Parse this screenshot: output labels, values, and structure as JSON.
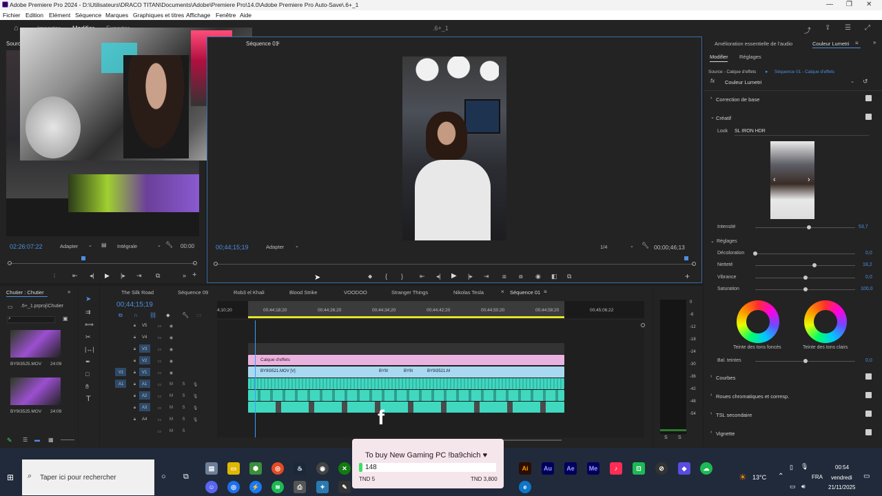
{
  "window": {
    "title": "Adobe Premiere Pro 2024 - D:\\Utilisateurs\\DRACO TITAN\\Documents\\Adobe\\Premiere Pro\\14.0\\Adobe Premiere Pro Auto-Save\\.6+_1"
  },
  "menu": [
    "Fichier",
    "Edition",
    "Elément",
    "Séquence",
    "Marques",
    "Graphiques et titres",
    "Affichage",
    "Fenêtre",
    "Aide"
  ],
  "workspace": {
    "tabs": [
      "Importer",
      "Modifier",
      "Exporter"
    ],
    "project_name": ".6+_1"
  },
  "source_monitor": {
    "tab": "Source",
    "timecode": "02:26:07:22",
    "fit": "Adapter",
    "quality": "Intégrale",
    "duration": "00:00"
  },
  "program_monitor": {
    "tab": "Séquence 01",
    "timecode": "00;44;15;19",
    "fit": "Adapter",
    "resolution": "1/4",
    "duration": "00;00;46;13"
  },
  "project_panel": {
    "tab": "Chutier : Chutier",
    "path": ".6+_1.prproj\\Chutier",
    "items": [
      {
        "name": "BY9I3525.MOV",
        "duration": "24:09"
      },
      {
        "name": "BY9I3525.MOV",
        "duration": "24:09"
      }
    ]
  },
  "timeline": {
    "tabs": [
      "The Silk Road",
      "Séquence 09",
      "Rob3 el Khali",
      "Blood Strike",
      "VOODOO",
      "Stranger Things",
      "Nikolas Tesla",
      "Séquence 01"
    ],
    "timecode": "00;44;15;19",
    "ruler": [
      "4;10;20",
      "00;44;18;20",
      "00;44;26;20",
      "00;44;34;20",
      "00;44;42;20",
      "00;44;50;20",
      "00;44;58;20",
      "00;45;06;22"
    ],
    "video_tracks": [
      "V5",
      "V4",
      "V3",
      "V2",
      "V1"
    ],
    "audio_tracks": [
      "A1",
      "A2",
      "A3",
      "A4"
    ],
    "source_patch": {
      "video": "V1",
      "audio": "A1"
    },
    "clips": {
      "adjustment": "Calque d'effets",
      "v1": [
        "BY9I3521.MOV [V]",
        "BY9I",
        "BY9I",
        "BY9I3521.M"
      ]
    },
    "meter_scale": [
      "0",
      "-6",
      "-12",
      "-18",
      "-24",
      "-30",
      "-36",
      "-42",
      "-48",
      "-54"
    ],
    "meter_solo": [
      "S",
      "S"
    ]
  },
  "right_panel": {
    "tabs": [
      "Amélioration essentielle de l'audio",
      "Couleur Lumetri"
    ],
    "subtabs": [
      "Modifier",
      "Réglages"
    ],
    "source_label": "Source - Calque d'effets",
    "sequence_label": "Séquence 01 - Calque d'effets",
    "fx_name": "Couleur Lumetri",
    "sections": {
      "basic": "Correction de base",
      "creative": "Créatif",
      "curves": "Courbes",
      "wheels": "Roues chromatiques et corresp.",
      "hsl": "TSL secondaire",
      "vignette": "Vignette"
    },
    "look_label": "Look",
    "look_value": "SL IRON HDR",
    "intensity": {
      "label": "Intensité",
      "value": "53,7",
      "level": 0.537
    },
    "adjustments_header": "Réglages",
    "sliders": [
      {
        "label": "Décoloration",
        "value": "0,0",
        "level": 0.0
      },
      {
        "label": "Netteté",
        "value": "18,2",
        "level": 0.59
      },
      {
        "label": "Vibrance",
        "value": "0,0",
        "level": 0.5
      },
      {
        "label": "Saturation",
        "value": "100,0",
        "level": 0.5
      }
    ],
    "shadow_tint": "Teinte des tons foncés",
    "highlight_tint": "Teinte des tons clairs",
    "tint_balance": {
      "label": "Bal. teintes",
      "value": "0,0",
      "level": 0.5
    }
  },
  "overlay": {
    "message": "To buy New Gaming PC !ba9chich ♥",
    "progress_value": "148",
    "progress_level": 0.024,
    "min": "TND 5",
    "max": "TND 3,800"
  },
  "taskbar": {
    "search_placeholder": "Taper ici pour rechercher",
    "weather": "13°C",
    "language": "FRA",
    "time": "00:54",
    "day": "vendredi",
    "date": "21/11/2025",
    "app_labels": [
      "Au",
      "Ae",
      "Me",
      "Ai"
    ]
  },
  "colors": {
    "accent_blue": "#4d8fe0",
    "playhead": "#3b9cff",
    "audio_clip": "#41d8c0",
    "video_clip": "#a9d9f0",
    "adjustment_clip": "#e8b4df"
  }
}
